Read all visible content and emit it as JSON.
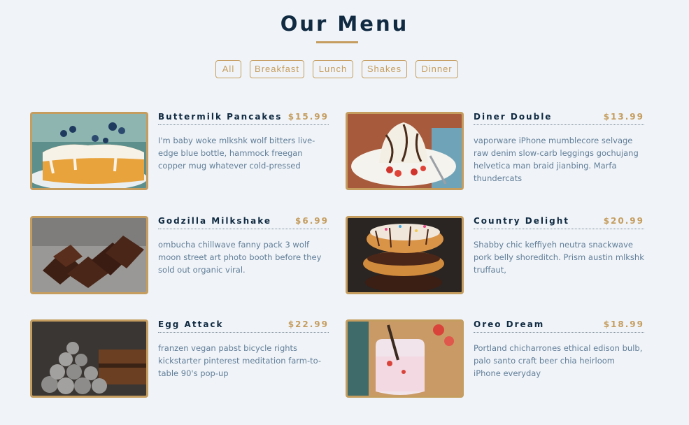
{
  "page": {
    "title": "Our Menu"
  },
  "filters": [
    "All",
    "Breakfast",
    "Lunch",
    "Shakes",
    "Dinner"
  ],
  "colors": {
    "accent": "#c59d5f",
    "heading": "#102a42",
    "text": "#617d98",
    "background": "#f0f4f8"
  },
  "menu": {
    "items": [
      {
        "name": "Buttermilk Pancakes",
        "price": "$15.99",
        "desc": "I'm baby woke mlkshk wolf bitters live-edge blue bottle, hammock freegan copper mug whatever cold-pressed",
        "image": "pancakes-image"
      },
      {
        "name": "Diner Double",
        "price": "$13.99",
        "desc": "vaporware iPhone mumblecore selvage raw denim slow-carb leggings gochujang helvetica man braid jianbing. Marfa thundercats",
        "image": "dessert-plate-image"
      },
      {
        "name": "Godzilla Milkshake",
        "price": "$6.99",
        "desc": "ombucha chillwave fanny pack 3 wolf moon street art photo booth before they sold out organic viral.",
        "image": "brownies-image"
      },
      {
        "name": "Country Delight",
        "price": "$20.99",
        "desc": "Shabby chic keffiyeh neutra snackwave pork belly shoreditch. Prism austin mlkshk truffaut,",
        "image": "donuts-image"
      },
      {
        "name": "Egg Attack",
        "price": "$22.99",
        "desc": "franzen vegan pabst bicycle rights kickstarter pinterest meditation farm-to-table 90's pop-up",
        "image": "truffles-image"
      },
      {
        "name": "Oreo Dream",
        "price": "$18.99",
        "desc": "Portland chicharrones ethical edison bulb, palo santo craft beer chia heirloom iPhone everyday",
        "image": "shake-jar-image"
      }
    ]
  }
}
